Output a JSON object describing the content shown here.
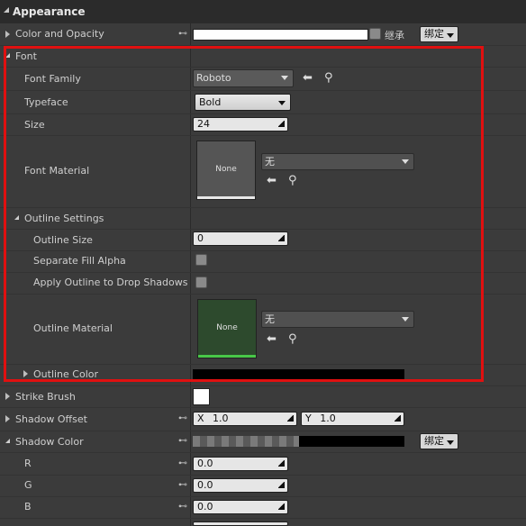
{
  "section": {
    "title": "Appearance"
  },
  "rows": {
    "color_opacity": {
      "label": "Color and Opacity",
      "inherit_label": "继承",
      "bind_label": "绑定"
    },
    "font": {
      "label": "Font"
    },
    "font_family": {
      "label": "Font Family",
      "value": "Roboto"
    },
    "typeface": {
      "label": "Typeface",
      "value": "Bold"
    },
    "size": {
      "label": "Size",
      "value": "24"
    },
    "font_material": {
      "label": "Font Material",
      "thumb_text": "None",
      "combo_value": "无"
    },
    "outline_settings": {
      "label": "Outline Settings"
    },
    "outline_size": {
      "label": "Outline Size",
      "value": "0"
    },
    "separate_fill_alpha": {
      "label": "Separate Fill Alpha"
    },
    "apply_outline": {
      "label": "Apply Outline to Drop Shadows"
    },
    "outline_material": {
      "label": "Outline Material",
      "thumb_text": "None",
      "combo_value": "无"
    },
    "outline_color": {
      "label": "Outline Color"
    },
    "strike_brush": {
      "label": "Strike Brush"
    },
    "shadow_offset": {
      "label": "Shadow Offset",
      "x_label": "X",
      "x_value": "1.0",
      "y_label": "Y",
      "y_value": "1.0"
    },
    "shadow_color": {
      "label": "Shadow Color",
      "bind_label": "绑定"
    },
    "r": {
      "label": "R",
      "value": "0.0"
    },
    "g": {
      "label": "G",
      "value": "0.0"
    },
    "b": {
      "label": "B",
      "value": "0.0"
    }
  },
  "colors": {
    "highlight": "#e01010",
    "outline_thumb": "#2d4a2d"
  }
}
